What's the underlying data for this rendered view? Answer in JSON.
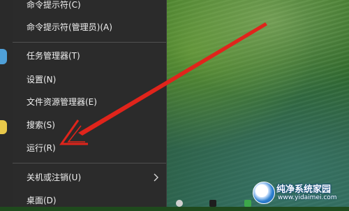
{
  "start_menu": {
    "items": [
      {
        "label": "命令提示符(C)"
      },
      {
        "label": "命令提示符(管理员)(A)"
      },
      {
        "label": "任务管理器(T)"
      },
      {
        "label": "设置(N)"
      },
      {
        "label": "文件资源管理器(E)"
      },
      {
        "label": "搜索(S)"
      },
      {
        "label": "运行(R)"
      },
      {
        "label": "关机或注销(U)"
      },
      {
        "label": "桌面(D)"
      }
    ],
    "submenu_chevron": "chevron-right-icon"
  },
  "watermark": {
    "title": "纯净系统家园",
    "url": "www.yidaimei.com"
  },
  "colors": {
    "menu_bg": "#2b2b2b",
    "menu_text": "#f0f0f0",
    "annotation_arrow": "#e0241b"
  }
}
